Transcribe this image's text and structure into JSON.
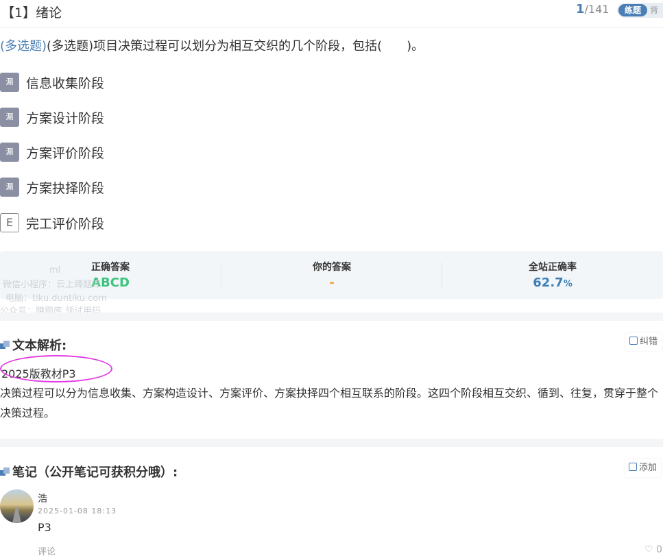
{
  "header": {
    "title": "【1】绪论",
    "current": "1",
    "total": "/141",
    "mode_active": "练题",
    "mode_other": "背"
  },
  "question": {
    "tag": "(多选题)",
    "text": "(多选题)项目决策过程可以划分为相互交织的几个阶段，包括(　　)。"
  },
  "options": [
    {
      "badge": "漏",
      "text": "信息收集阶段"
    },
    {
      "badge": "漏",
      "text": "方案设计阶段"
    },
    {
      "badge": "漏",
      "text": "方案评价阶段"
    },
    {
      "badge": "漏",
      "text": "方案抉择阶段"
    },
    {
      "badge": "E",
      "text": "完工评价阶段"
    }
  ],
  "stats": {
    "correct_label": "正确答案",
    "correct_value": "ABCD",
    "yours_label": "你的答案",
    "yours_value": "-",
    "rate_label": "全站正确率",
    "rate_value": "62.7",
    "rate_unit": "%"
  },
  "watermark": {
    "line0": "ml",
    "line1": "微信小程序：云上蹲题库",
    "line2": "电脑：tiku.duntiku.com",
    "line3": "公众号：蹲题库 领试用码"
  },
  "analysis": {
    "title": "文本解析:",
    "report_label": "纠错",
    "source": "2025版教材P3",
    "body": "决策过程可以分为信息收集、方案构造设计、方案评价、方案抉择四个相互联系的阶段。这四个阶段相互交织、循到、往复，贯穿于整个决策过程。"
  },
  "notes": {
    "title": "笔记（公开笔记可获积分哦）:",
    "add_label": "添加",
    "items": [
      {
        "user": "浩",
        "time": "2025-01-08 18:13",
        "text": "P3",
        "comment_label": "评论",
        "likes": "0"
      }
    ]
  },
  "colors": {
    "accent": "#4a7fb5",
    "correct": "#3cc47c",
    "yours": "#f39c32",
    "rate": "#3e7fb8",
    "annotation": "#e23be2"
  }
}
